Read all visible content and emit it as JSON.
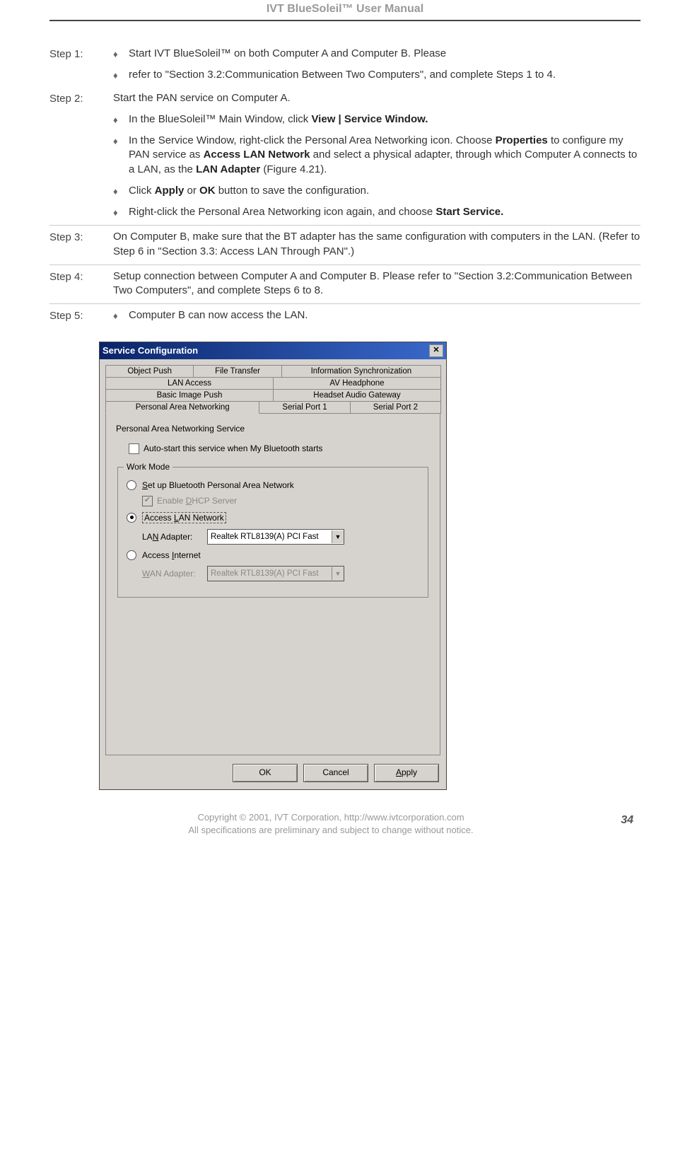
{
  "header": "IVT BlueSoleil™ User Manual",
  "steps": {
    "s1": {
      "label": "Step 1:",
      "b1": "Start IVT BlueSoleil™ on both Computer A and Computer B. Please",
      "b2": "refer to \"Section 3.2:Communication Between Two Computers\", and complete Steps 1 to 4."
    },
    "s2": {
      "label": "Step 2:",
      "intro": "Start the PAN service on Computer A.",
      "b1_pre": "In the BlueSoleil™ Main Window, click ",
      "b1_bold": "View | Service Window.",
      "b2_a": "In the Service Window, right-click the Personal Area Networking icon. Choose ",
      "b2_b": "Properties",
      "b2_c": " to configure my PAN service as ",
      "b2_d": "Access LAN Network",
      "b2_e": " and select a physical adapter, through which Computer A connects to a LAN, as the ",
      "b2_f": "LAN Adapter",
      "b2_g": " (Figure 4.21).",
      "b3_a": " Click ",
      "b3_b": "Apply",
      "b3_c": " or ",
      "b3_d": "OK",
      "b3_e": " button to save the configuration.",
      "b4_a": "Right-click the Personal Area Networking icon again, and choose ",
      "b4_b": "Start Service."
    },
    "s3": {
      "label": "Step 3:",
      "text": "On Computer B, make sure that the BT adapter has the same configuration with computers in the LAN. (Refer to Step 6 in \"Section 3.3: Access LAN Through PAN\".)"
    },
    "s4": {
      "label": "Step 4:",
      "text": "Setup connection between Computer A and Computer B. Please refer to \"Section 3.2:Communication Between Two Computers\", and complete Steps 6 to 8."
    },
    "s5": {
      "label": "Step 5:",
      "b1": "Computer B can now access the LAN."
    }
  },
  "dialog": {
    "title": "Service Configuration",
    "tabs_row1": [
      "Object Push",
      "File Transfer",
      "Information Synchronization"
    ],
    "tabs_row2": [
      "LAN Access",
      "AV Headphone"
    ],
    "tabs_row3": [
      "Basic Image Push",
      "Headset Audio Gateway"
    ],
    "tabs_row4": [
      "Personal Area Networking",
      "Serial Port 1",
      "Serial Port 2"
    ],
    "service_label": "Personal Area Networking Service",
    "autostart": "Auto-start this service when My Bluetooth starts",
    "workmode_legend": "Work Mode",
    "radio1_pre": "S",
    "radio1_mid": "et up Bluetooth Personal Area Network",
    "dhcp_pre": "Enable ",
    "dhcp_u": "D",
    "dhcp_post": "HCP Server",
    "radio2_pre": "Access ",
    "radio2_u": "L",
    "radio2_post": "AN Network",
    "lan_label_pre": "LA",
    "lan_label_u": "N",
    "lan_label_post": " Adapter:",
    "lan_value": "Realtek RTL8139(A) PCI Fast",
    "radio3_pre": "Access ",
    "radio3_u": "I",
    "radio3_post": "nternet",
    "wan_label_pre": "",
    "wan_label_u": "W",
    "wan_label_post": "AN Adapter:",
    "wan_value": "Realtek RTL8139(A) PCI Fast",
    "btn_ok": "OK",
    "btn_cancel": "Cancel",
    "btn_apply_u": "A",
    "btn_apply_post": "pply"
  },
  "footer": {
    "line1": "Copyright © 2001, IVT Corporation, http://www.ivtcorporation.com",
    "line2": "All specifications are preliminary and subject to change without notice.",
    "page": "34"
  }
}
